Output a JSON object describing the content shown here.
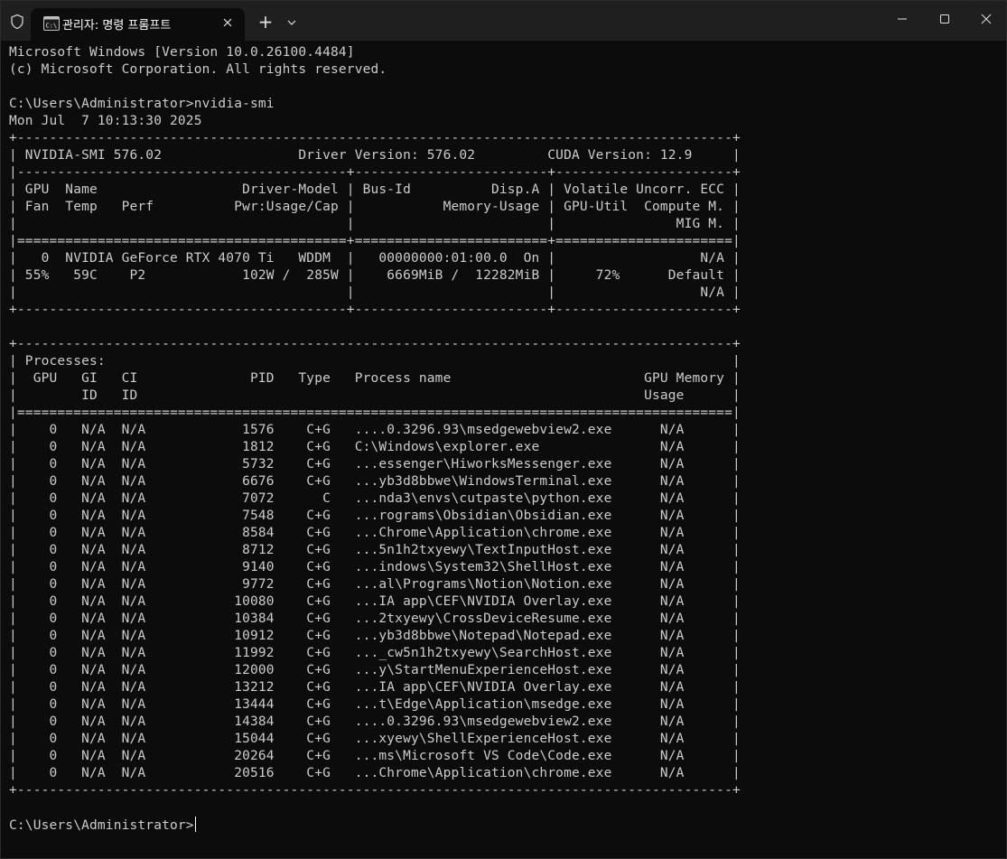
{
  "window": {
    "title": "관리자: 명령 프롬프트",
    "new_tab_label": "+"
  },
  "icons": {
    "shield": "shield-icon",
    "tab": "command-prompt-icon",
    "close_tab": "close-icon",
    "dropdown": "chevron-down-icon",
    "minimize": "minimize-icon",
    "maximize": "maximize-icon",
    "close_window": "close-icon"
  },
  "colors": {
    "background": "#0c0c0c",
    "titlebar": "#1f1f1f",
    "text": "#cccccc"
  },
  "terminal": {
    "lines": [
      "Microsoft Windows [Version 10.0.26100.4484]",
      "(c) Microsoft Corporation. All rights reserved.",
      "",
      "C:\\Users\\Administrator>nvidia-smi",
      "Mon Jul  7 10:13:30 2025",
      "+-----------------------------------------------------------------------------------------+",
      "| NVIDIA-SMI 576.02                 Driver Version: 576.02         CUDA Version: 12.9     |",
      "|-----------------------------------------+------------------------+----------------------+",
      "| GPU  Name                  Driver-Model | Bus-Id          Disp.A | Volatile Uncorr. ECC |",
      "| Fan  Temp   Perf          Pwr:Usage/Cap |           Memory-Usage | GPU-Util  Compute M. |",
      "|                                         |                        |               MIG M. |",
      "|=========================================+========================+======================|",
      "|   0  NVIDIA GeForce RTX 4070 Ti   WDDM  |   00000000:01:00.0  On |                  N/A |",
      "| 55%   59C    P2            102W /  285W |    6669MiB /  12282MiB |     72%      Default |",
      "|                                         |                        |                  N/A |",
      "+-----------------------------------------+------------------------+----------------------+",
      "",
      "+-----------------------------------------------------------------------------------------+",
      "| Processes:                                                                              |",
      "|  GPU   GI   CI              PID   Type   Process name                        GPU Memory |",
      "|        ID   ID                                                               Usage      |",
      "|=========================================================================================|",
      "|    0   N/A  N/A            1576    C+G   ....0.3296.93\\msedgewebview2.exe      N/A      |",
      "|    0   N/A  N/A            1812    C+G   C:\\Windows\\explorer.exe               N/A      |",
      "|    0   N/A  N/A            5732    C+G   ...essenger\\HiworksMessenger.exe      N/A      |",
      "|    0   N/A  N/A            6676    C+G   ...yb3d8bbwe\\WindowsTerminal.exe      N/A      |",
      "|    0   N/A  N/A            7072      C   ...nda3\\envs\\cutpaste\\python.exe      N/A      |",
      "|    0   N/A  N/A            7548    C+G   ...rograms\\Obsidian\\Obsidian.exe      N/A      |",
      "|    0   N/A  N/A            8584    C+G   ...Chrome\\Application\\chrome.exe      N/A      |",
      "|    0   N/A  N/A            8712    C+G   ...5n1h2txyewy\\TextInputHost.exe      N/A      |",
      "|    0   N/A  N/A            9140    C+G   ...indows\\System32\\ShellHost.exe      N/A      |",
      "|    0   N/A  N/A            9772    C+G   ...al\\Programs\\Notion\\Notion.exe      N/A      |",
      "|    0   N/A  N/A           10080    C+G   ...IA app\\CEF\\NVIDIA Overlay.exe      N/A      |",
      "|    0   N/A  N/A           10384    C+G   ...2txyewy\\CrossDeviceResume.exe      N/A      |",
      "|    0   N/A  N/A           10912    C+G   ...yb3d8bbwe\\Notepad\\Notepad.exe      N/A      |",
      "|    0   N/A  N/A           11992    C+G   ..._cw5n1h2txyewy\\SearchHost.exe      N/A      |",
      "|    0   N/A  N/A           12000    C+G   ...y\\StartMenuExperienceHost.exe      N/A      |",
      "|    0   N/A  N/A           13212    C+G   ...IA app\\CEF\\NVIDIA Overlay.exe      N/A      |",
      "|    0   N/A  N/A           13444    C+G   ...t\\Edge\\Application\\msedge.exe      N/A      |",
      "|    0   N/A  N/A           14384    C+G   ....0.3296.93\\msedgewebview2.exe      N/A      |",
      "|    0   N/A  N/A           15044    C+G   ...xyewy\\ShellExperienceHost.exe      N/A      |",
      "|    0   N/A  N/A           20264    C+G   ...ms\\Microsoft VS Code\\Code.exe      N/A      |",
      "|    0   N/A  N/A           20516    C+G   ...Chrome\\Application\\chrome.exe      N/A      |",
      "+-----------------------------------------------------------------------------------------+",
      ""
    ],
    "prompt": "C:\\Users\\Administrator>"
  }
}
